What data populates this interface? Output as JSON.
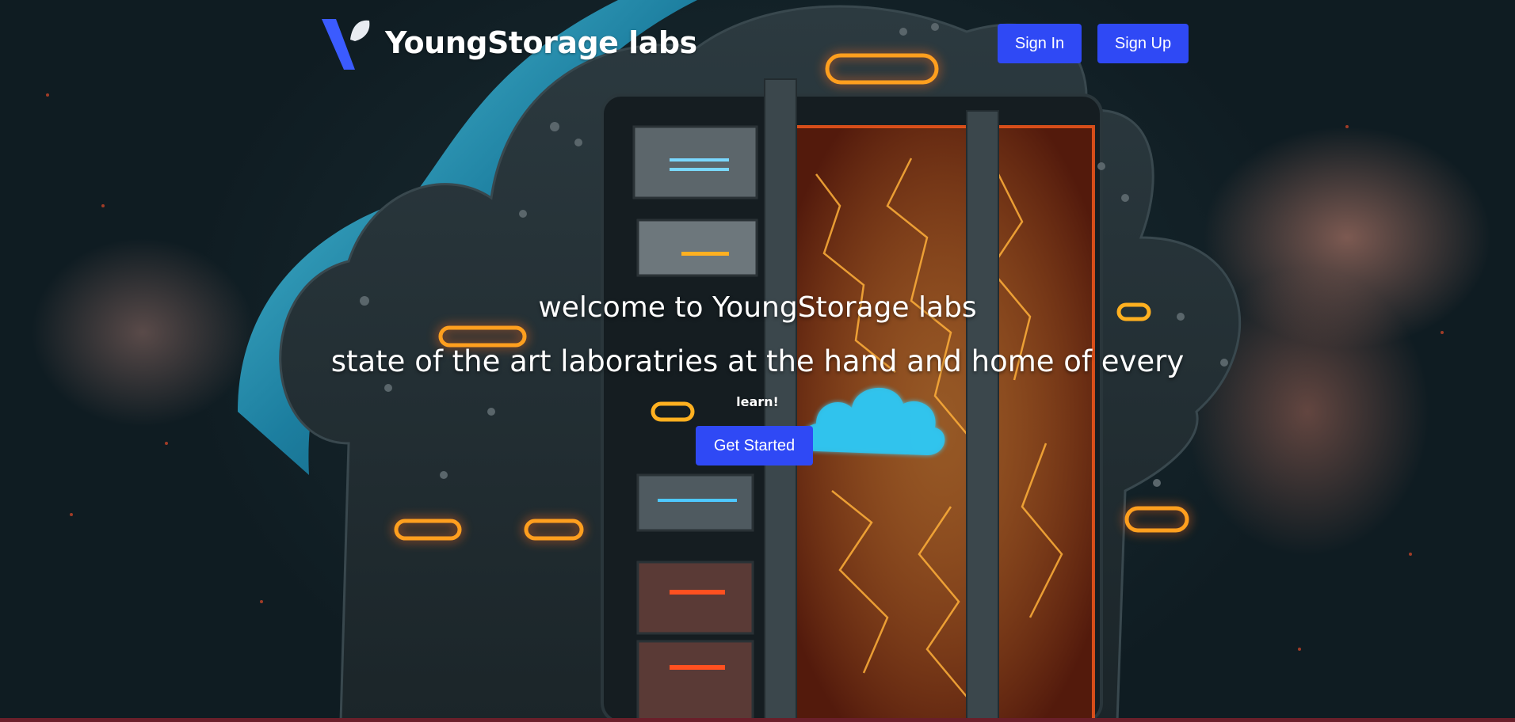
{
  "nav": {
    "brand_name": "YoungStorage labs",
    "sign_in_label": "Sign In",
    "sign_up_label": "Sign Up"
  },
  "hero": {
    "headline": "welcome to YoungStorage labs",
    "subline": "state of the art laboratries at the hand and home of every",
    "subline_end": "learn!",
    "cta_label": "Get Started"
  },
  "colors": {
    "button_bg": "#2f49f5",
    "button_text": "#ffffff",
    "neon_orange": "#ff7a1a",
    "neon_cyan": "#3fd6ff"
  },
  "icons": {
    "logo": "brand-logo-icon",
    "cloud": "cloud-icon"
  }
}
